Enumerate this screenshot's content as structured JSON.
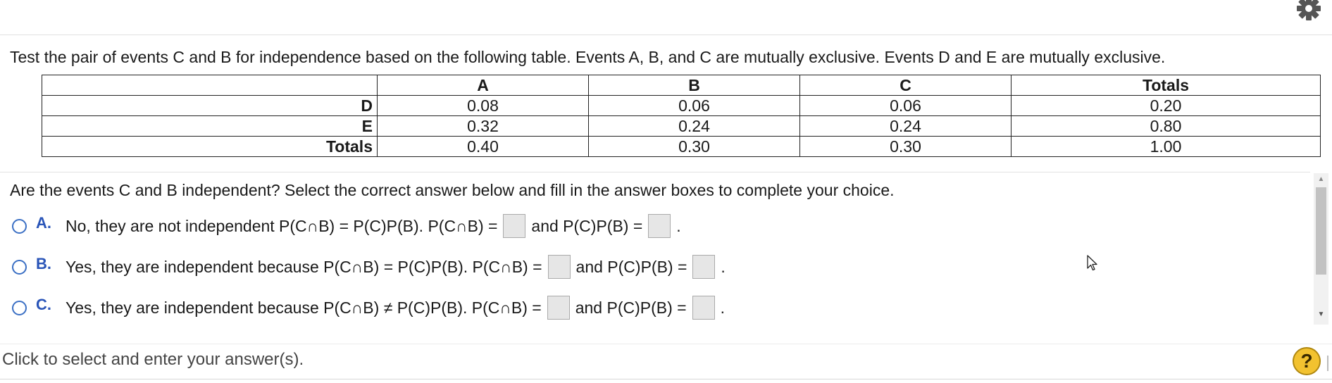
{
  "question": "Test the pair of events C and B for independence based on the following table. Events A, B, and C are mutually exclusive. Events D and E are mutually exclusive.",
  "table": {
    "headers": [
      "",
      "A",
      "B",
      "C",
      "Totals"
    ],
    "rows": [
      {
        "label": "D",
        "cells": [
          "0.08",
          "0.06",
          "0.06",
          "0.20"
        ]
      },
      {
        "label": "E",
        "cells": [
          "0.32",
          "0.24",
          "0.24",
          "0.80"
        ]
      },
      {
        "label": "Totals",
        "cells": [
          "0.40",
          "0.30",
          "0.30",
          "1.00"
        ]
      }
    ]
  },
  "prompt": "Are the events C and B independent? Select the correct answer below and fill in the answer boxes to complete your choice.",
  "options": [
    {
      "letter": "A.",
      "text": "No, they are not independent P(C∩B) = P(C)P(B). P(C∩B) =",
      "middle": "and P(C)P(B) =",
      "end": "."
    },
    {
      "letter": "B.",
      "text": "Yes, they are independent because P(C∩B) = P(C)P(B). P(C∩B) =",
      "middle": "and P(C)P(B) =",
      "end": "."
    },
    {
      "letter": "C.",
      "text": "Yes, they are independent because P(C∩B) ≠ P(C)P(B). P(C∩B) =",
      "middle": "and P(C)P(B) =",
      "end": "."
    }
  ],
  "footer": {
    "text": "Click to select and enter your answer(s).",
    "help_label": "?"
  },
  "icons": {
    "settings": "gear-icon",
    "help": "help-icon",
    "radio": "radio-button-icon",
    "cursor": "mouse-pointer-icon"
  },
  "colors": {
    "accent": "#2a55b8",
    "radio": "#3a6fc4",
    "answer_box": "#e6e6e6",
    "help": "#f2c230"
  }
}
